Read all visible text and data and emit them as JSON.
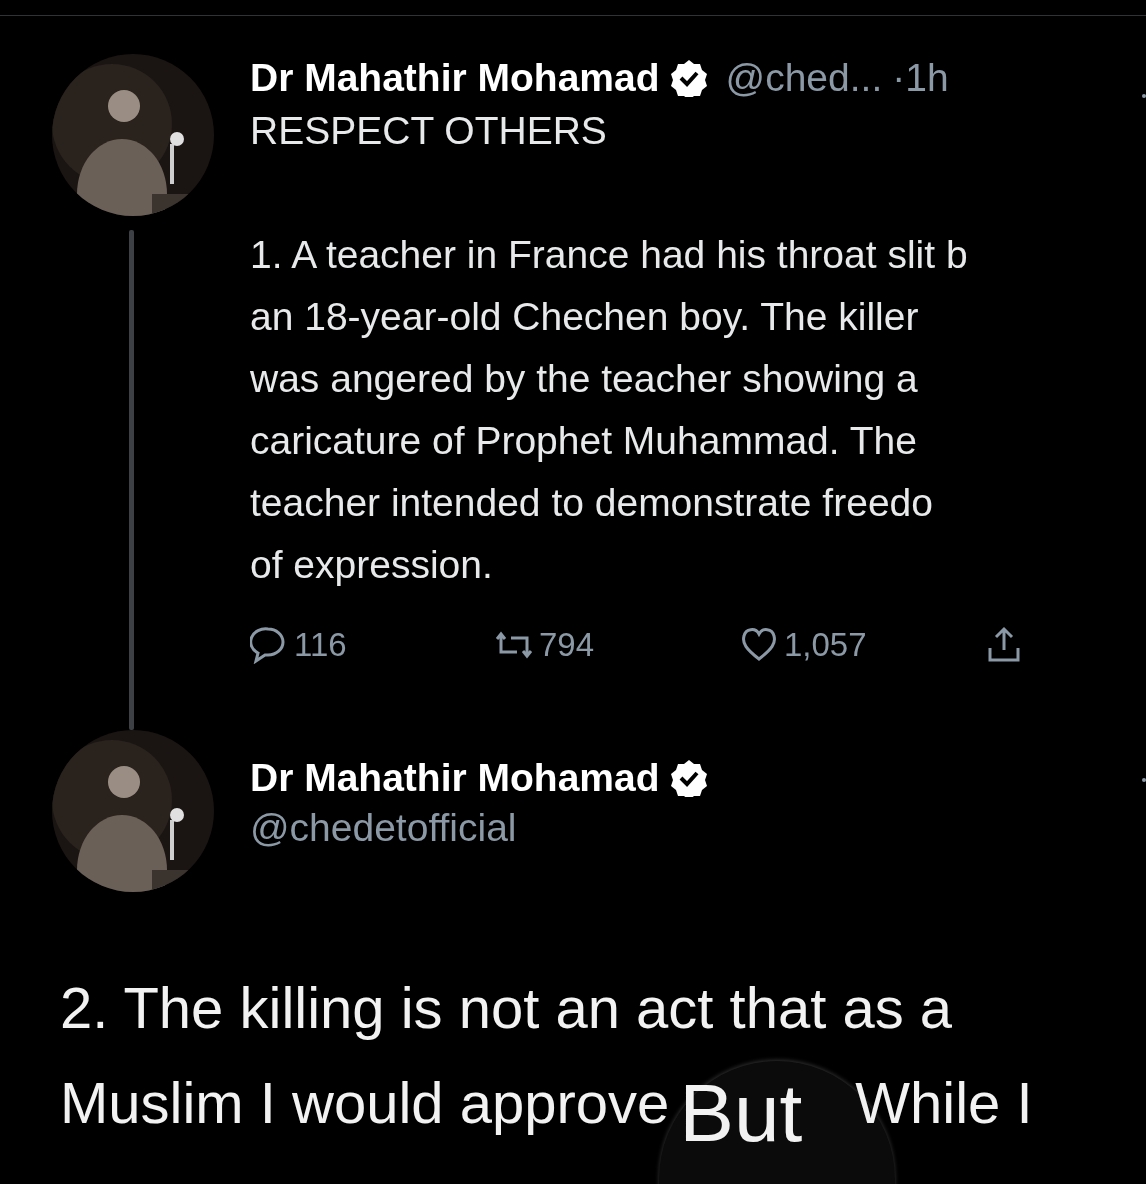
{
  "tweets": [
    {
      "author": {
        "name": "Dr Mahathir Mohamad",
        "verified": true,
        "handle": "@ched...",
        "time": "·1h"
      },
      "title": "RESPECT OTHERS",
      "body_lines": [
        "1. A teacher in France had his throat slit b",
        "an 18-year-old Chechen boy. The killer",
        "was angered by the teacher showing a",
        "caricature of Prophet Muhammad. The",
        "teacher intended to demonstrate freedo",
        "of expression."
      ],
      "actions": [
        {
          "kind": "reply",
          "count": "116"
        },
        {
          "kind": "retweet",
          "count": "794"
        },
        {
          "kind": "like",
          "count": "1,057"
        },
        {
          "kind": "share"
        }
      ]
    },
    {
      "author": {
        "name": "Dr Mahathir Mohamad",
        "verified": true,
        "handle": "@chedetofficial"
      },
      "big_lines": [
        "2. The killing is not an act that as a",
        "Muslim I would approve"
      ],
      "loupe": {
        "text": "But",
        "after": "While I"
      }
    }
  ]
}
